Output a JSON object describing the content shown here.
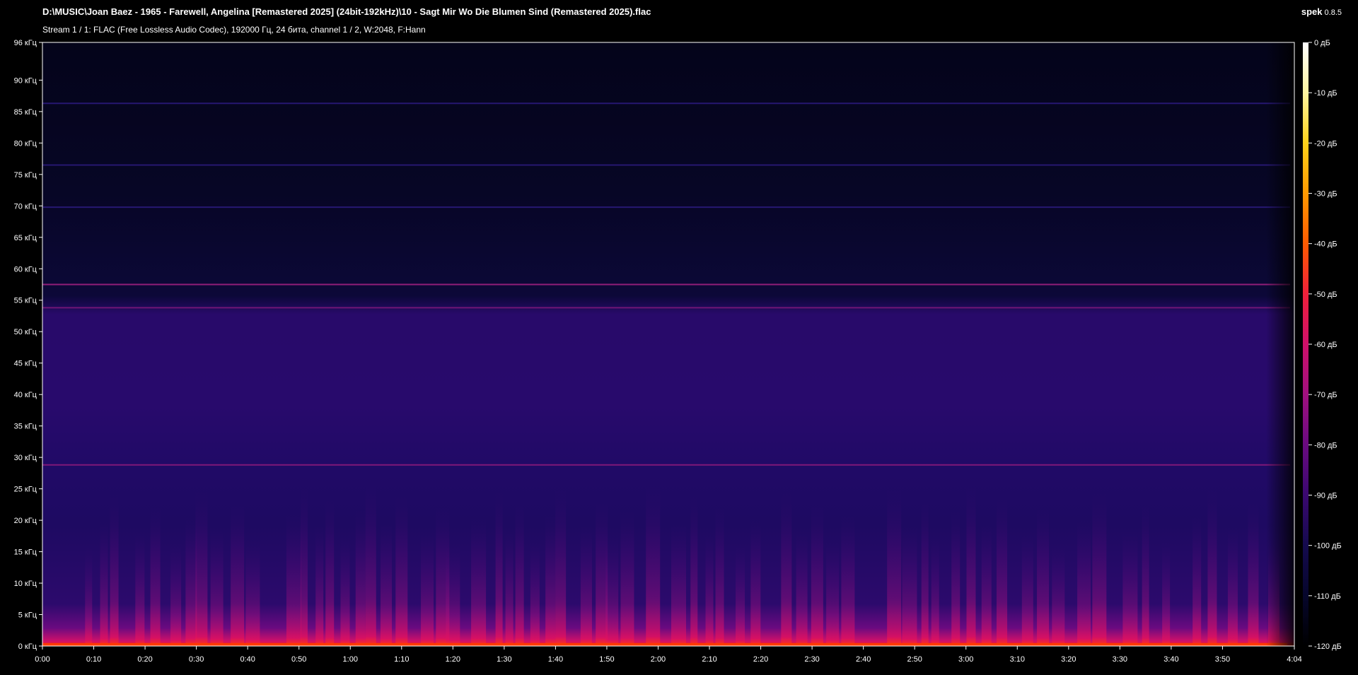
{
  "header": {
    "title": "D:\\MUSIC\\Joan Baez - 1965 - Farewell, Angelina [Remastered 2025] (24bit-192kHz)\\10 - Sagt Mir Wo Die Blumen Sind (Remastered 2025).flac",
    "subtitle": "Stream 1 / 1: FLAC (Free Lossless Audio Codec), 192000 Гц, 24 бита, channel 1 / 2, W:2048, F:Hann",
    "app_name": "spek",
    "app_version": "0.8.5"
  },
  "chart_data": {
    "type": "heatmap",
    "y_axis": {
      "range": [
        0,
        96
      ],
      "unit": "кГц",
      "ticks": [
        "0 кГц",
        "5 кГц",
        "10 кГц",
        "15 кГц",
        "20 кГц",
        "25 кГц",
        "30 кГц",
        "35 кГц",
        "40 кГц",
        "45 кГц",
        "50 кГц",
        "55 кГц",
        "60 кГц",
        "65 кГц",
        "70 кГц",
        "75 кГц",
        "80 кГц",
        "85 кГц",
        "90 кГц",
        "96 кГц"
      ],
      "tick_values": [
        0,
        5,
        10,
        15,
        20,
        25,
        30,
        35,
        40,
        45,
        50,
        55,
        60,
        65,
        70,
        75,
        80,
        85,
        90,
        96
      ]
    },
    "x_axis": {
      "range_seconds": [
        0,
        244
      ],
      "ticks": [
        "0:00",
        "0:10",
        "0:20",
        "0:30",
        "0:40",
        "0:50",
        "1:00",
        "1:10",
        "1:20",
        "1:30",
        "1:40",
        "1:50",
        "2:00",
        "2:10",
        "2:20",
        "2:30",
        "2:40",
        "2:50",
        "3:00",
        "3:10",
        "3:20",
        "3:30",
        "3:40",
        "3:50",
        "4:04"
      ],
      "tick_values": [
        0,
        10,
        20,
        30,
        40,
        50,
        60,
        70,
        80,
        90,
        100,
        110,
        120,
        130,
        140,
        150,
        160,
        170,
        180,
        190,
        200,
        210,
        220,
        230,
        244
      ]
    },
    "color_scale": {
      "range_db": [
        -120,
        0
      ],
      "ticks": [
        "0 дБ",
        "-10 дБ",
        "-20 дБ",
        "-30 дБ",
        "-40 дБ",
        "-50 дБ",
        "-60 дБ",
        "-70 дБ",
        "-80 дБ",
        "-90 дБ",
        "-100 дБ",
        "-110 дБ",
        "-120 дБ"
      ],
      "tick_values": [
        0,
        -10,
        -20,
        -30,
        -40,
        -50,
        -60,
        -70,
        -80,
        -90,
        -100,
        -110,
        -120
      ],
      "colors": [
        "#ffffff",
        "#fff5a0",
        "#ffd21a",
        "#ff9900",
        "#ff5a00",
        "#f0203a",
        "#d0106a",
        "#a0107f",
        "#6a0a80",
        "#3a0870",
        "#140a4e",
        "#06062c",
        "#000000"
      ]
    },
    "tonal_lines_khz": [
      86.3,
      76.5,
      69.8,
      57.5,
      53.8,
      28.8
    ],
    "speech_bursts_seconds": [
      9,
      12,
      14,
      19,
      22,
      26,
      29,
      31,
      34,
      38,
      41,
      49,
      51,
      54,
      56,
      59,
      62,
      64,
      67,
      70,
      75,
      78,
      80,
      85,
      89,
      91,
      93,
      96,
      99,
      101,
      106,
      109,
      111,
      114,
      119,
      124,
      127,
      130,
      132,
      136,
      139,
      145,
      148,
      151,
      154,
      157,
      166,
      169,
      172,
      174,
      178,
      181,
      184,
      187,
      192,
      195,
      198,
      203,
      206,
      212,
      215,
      219,
      225,
      228,
      232,
      236,
      240
    ]
  }
}
